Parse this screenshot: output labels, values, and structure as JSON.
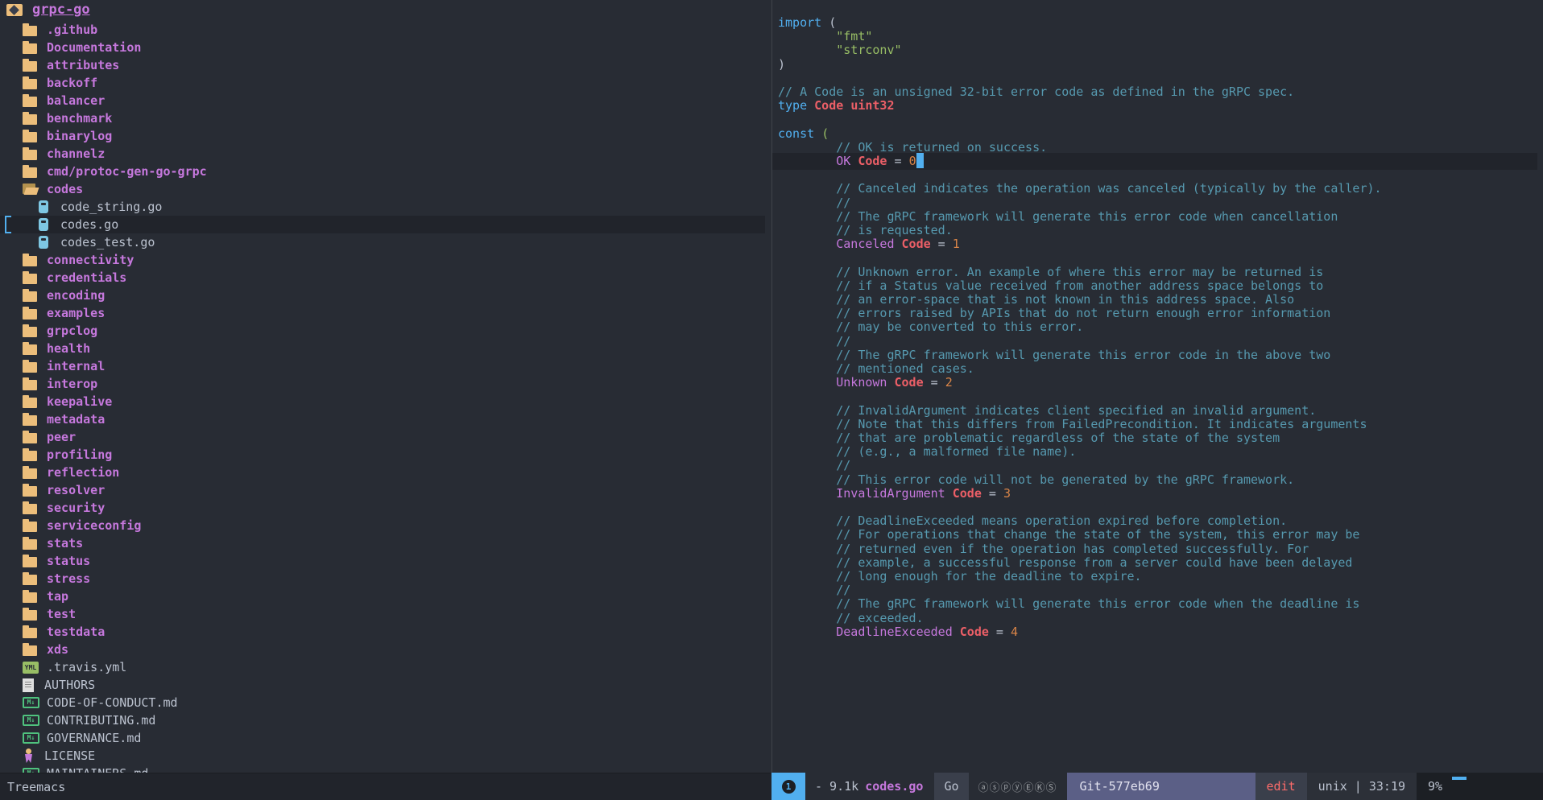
{
  "tree": {
    "root_label": "grpc-go",
    "rows": [
      {
        "label": ".github",
        "kind": "dir",
        "icon": "folder-icon"
      },
      {
        "label": "Documentation",
        "kind": "dir",
        "icon": "folder-icon"
      },
      {
        "label": "attributes",
        "kind": "dir",
        "icon": "folder-icon"
      },
      {
        "label": "backoff",
        "kind": "dir",
        "icon": "folder-icon"
      },
      {
        "label": "balancer",
        "kind": "dir",
        "icon": "folder-icon"
      },
      {
        "label": "benchmark",
        "kind": "dir",
        "icon": "folder-icon"
      },
      {
        "label": "binarylog",
        "kind": "dir",
        "icon": "folder-icon"
      },
      {
        "label": "channelz",
        "kind": "dir",
        "icon": "folder-icon"
      },
      {
        "label": "cmd/protoc-gen-go-grpc",
        "kind": "dir",
        "icon": "folder-icon"
      },
      {
        "label": "codes",
        "kind": "dir",
        "icon": "folder-open-icon",
        "open": true
      },
      {
        "label": "code_string.go",
        "kind": "file",
        "icon": "go-file-icon",
        "child": true
      },
      {
        "label": "codes.go",
        "kind": "file",
        "icon": "go-file-icon",
        "child": true,
        "selected": true
      },
      {
        "label": "codes_test.go",
        "kind": "file",
        "icon": "go-file-icon",
        "child": true
      },
      {
        "label": "connectivity",
        "kind": "dir",
        "icon": "folder-icon"
      },
      {
        "label": "credentials",
        "kind": "dir",
        "icon": "folder-icon"
      },
      {
        "label": "encoding",
        "kind": "dir",
        "icon": "folder-icon"
      },
      {
        "label": "examples",
        "kind": "dir",
        "icon": "folder-icon"
      },
      {
        "label": "grpclog",
        "kind": "dir",
        "icon": "folder-icon"
      },
      {
        "label": "health",
        "kind": "dir",
        "icon": "folder-icon"
      },
      {
        "label": "internal",
        "kind": "dir",
        "icon": "folder-icon"
      },
      {
        "label": "interop",
        "kind": "dir",
        "icon": "folder-icon"
      },
      {
        "label": "keepalive",
        "kind": "dir",
        "icon": "folder-icon"
      },
      {
        "label": "metadata",
        "kind": "dir",
        "icon": "folder-icon"
      },
      {
        "label": "peer",
        "kind": "dir",
        "icon": "folder-icon"
      },
      {
        "label": "profiling",
        "kind": "dir",
        "icon": "folder-icon"
      },
      {
        "label": "reflection",
        "kind": "dir",
        "icon": "folder-icon"
      },
      {
        "label": "resolver",
        "kind": "dir",
        "icon": "folder-icon"
      },
      {
        "label": "security",
        "kind": "dir",
        "icon": "folder-icon"
      },
      {
        "label": "serviceconfig",
        "kind": "dir",
        "icon": "folder-icon"
      },
      {
        "label": "stats",
        "kind": "dir",
        "icon": "folder-icon"
      },
      {
        "label": "status",
        "kind": "dir",
        "icon": "folder-icon"
      },
      {
        "label": "stress",
        "kind": "dir",
        "icon": "folder-icon"
      },
      {
        "label": "tap",
        "kind": "dir",
        "icon": "folder-icon"
      },
      {
        "label": "test",
        "kind": "dir",
        "icon": "folder-icon"
      },
      {
        "label": "testdata",
        "kind": "dir",
        "icon": "folder-icon"
      },
      {
        "label": "xds",
        "kind": "dir",
        "icon": "folder-icon"
      },
      {
        "label": ".travis.yml",
        "kind": "file",
        "icon": "yaml-file-icon",
        "icon_text": "YML"
      },
      {
        "label": "AUTHORS",
        "kind": "file",
        "icon": "text-file-icon"
      },
      {
        "label": "CODE-OF-CONDUCT.md",
        "kind": "file",
        "icon": "markdown-file-icon",
        "icon_text": "M↓"
      },
      {
        "label": "CONTRIBUTING.md",
        "kind": "file",
        "icon": "markdown-file-icon",
        "icon_text": "M↓"
      },
      {
        "label": "GOVERNANCE.md",
        "kind": "file",
        "icon": "markdown-file-icon",
        "icon_text": "M↓"
      },
      {
        "label": "LICENSE",
        "kind": "file",
        "icon": "license-file-icon"
      },
      {
        "label": "MAINTAINERS.md",
        "kind": "file",
        "icon": "markdown-file-icon",
        "icon_text": "M↓"
      }
    ]
  },
  "editor": {
    "lines": [
      {
        "tokens": [
          [
            "kw",
            "import"
          ],
          [
            "punc",
            " ("
          ]
        ]
      },
      {
        "tokens": [
          [
            "str",
            "        \"fmt\""
          ]
        ]
      },
      {
        "tokens": [
          [
            "str",
            "        \"strconv\""
          ]
        ]
      },
      {
        "tokens": [
          [
            "punc",
            ")"
          ]
        ]
      },
      {
        "tokens": []
      },
      {
        "tokens": [
          [
            "cm",
            "// A Code is an unsigned 32-bit error code as defined in the gRPC spec."
          ]
        ]
      },
      {
        "tokens": [
          [
            "kw",
            "type "
          ],
          [
            "type",
            "Code"
          ],
          [
            "punc",
            " "
          ],
          [
            "type",
            "uint32"
          ]
        ]
      },
      {
        "tokens": []
      },
      {
        "tokens": [
          [
            "kw",
            "const "
          ],
          [
            "paren",
            "("
          ]
        ]
      },
      {
        "tokens": [
          [
            "cm",
            "        // OK is returned on success."
          ]
        ]
      },
      {
        "tokens": [
          [
            "const",
            "        OK "
          ],
          [
            "type",
            "Code"
          ],
          [
            "punc",
            " = "
          ],
          [
            "num",
            "0"
          ]
        ],
        "current": true
      },
      {
        "tokens": []
      },
      {
        "tokens": [
          [
            "cm",
            "        // Canceled indicates the operation was canceled (typically by the caller)."
          ]
        ]
      },
      {
        "tokens": [
          [
            "cm",
            "        //"
          ]
        ]
      },
      {
        "tokens": [
          [
            "cm",
            "        // The gRPC framework will generate this error code when cancellation"
          ]
        ]
      },
      {
        "tokens": [
          [
            "cm",
            "        // is requested."
          ]
        ]
      },
      {
        "tokens": [
          [
            "const",
            "        Canceled "
          ],
          [
            "type",
            "Code"
          ],
          [
            "punc",
            " = "
          ],
          [
            "num",
            "1"
          ]
        ]
      },
      {
        "tokens": []
      },
      {
        "tokens": [
          [
            "cm",
            "        // Unknown error. An example of where this error may be returned is"
          ]
        ]
      },
      {
        "tokens": [
          [
            "cm",
            "        // if a Status value received from another address space belongs to"
          ]
        ]
      },
      {
        "tokens": [
          [
            "cm",
            "        // an error-space that is not known in this address space. Also"
          ]
        ]
      },
      {
        "tokens": [
          [
            "cm",
            "        // errors raised by APIs that do not return enough error information"
          ]
        ]
      },
      {
        "tokens": [
          [
            "cm",
            "        // may be converted to this error."
          ]
        ]
      },
      {
        "tokens": [
          [
            "cm",
            "        //"
          ]
        ]
      },
      {
        "tokens": [
          [
            "cm",
            "        // The gRPC framework will generate this error code in the above two"
          ]
        ]
      },
      {
        "tokens": [
          [
            "cm",
            "        // mentioned cases."
          ]
        ]
      },
      {
        "tokens": [
          [
            "const",
            "        Unknown "
          ],
          [
            "type",
            "Code"
          ],
          [
            "punc",
            " = "
          ],
          [
            "num",
            "2"
          ]
        ]
      },
      {
        "tokens": []
      },
      {
        "tokens": [
          [
            "cm",
            "        // InvalidArgument indicates client specified an invalid argument."
          ]
        ]
      },
      {
        "tokens": [
          [
            "cm",
            "        // Note that this differs from FailedPrecondition. It indicates arguments"
          ]
        ]
      },
      {
        "tokens": [
          [
            "cm",
            "        // that are problematic regardless of the state of the system"
          ]
        ]
      },
      {
        "tokens": [
          [
            "cm",
            "        // (e.g., a malformed file name)."
          ]
        ]
      },
      {
        "tokens": [
          [
            "cm",
            "        //"
          ]
        ]
      },
      {
        "tokens": [
          [
            "cm",
            "        // This error code will not be generated by the gRPC framework."
          ]
        ]
      },
      {
        "tokens": [
          [
            "const",
            "        InvalidArgument "
          ],
          [
            "type",
            "Code"
          ],
          [
            "punc",
            " = "
          ],
          [
            "num",
            "3"
          ]
        ]
      },
      {
        "tokens": []
      },
      {
        "tokens": [
          [
            "cm",
            "        // DeadlineExceeded means operation expired before completion."
          ]
        ]
      },
      {
        "tokens": [
          [
            "cm",
            "        // For operations that change the state of the system, this error may be"
          ]
        ]
      },
      {
        "tokens": [
          [
            "cm",
            "        // returned even if the operation has completed successfully. For"
          ]
        ]
      },
      {
        "tokens": [
          [
            "cm",
            "        // example, a successful response from a server could have been delayed"
          ]
        ]
      },
      {
        "tokens": [
          [
            "cm",
            "        // long enough for the deadline to expire."
          ]
        ]
      },
      {
        "tokens": [
          [
            "cm",
            "        //"
          ]
        ]
      },
      {
        "tokens": [
          [
            "cm",
            "        // The gRPC framework will generate this error code when the deadline is"
          ]
        ]
      },
      {
        "tokens": [
          [
            "cm",
            "        // exceeded."
          ]
        ]
      },
      {
        "tokens": [
          [
            "const",
            "        DeadlineExceeded "
          ],
          [
            "type",
            "Code"
          ],
          [
            "punc",
            " = "
          ],
          [
            "num",
            "4"
          ]
        ]
      }
    ]
  },
  "modeline_left": {
    "label": "Treemacs"
  },
  "modeline": {
    "window_number": "1",
    "buffer_size": "- 9.1k",
    "buffer_name": "codes.go",
    "major_mode": "Go",
    "minor_flags": "ⓐⓢⓟⓨⒺⓀⓈ",
    "vcs": "Git-577eb69",
    "state": "edit",
    "eol_encoding": "unix | 33:19",
    "position_percent": "9%"
  },
  "colors": {
    "background": "#282c34",
    "keyword": "#51afef",
    "string": "#98be65",
    "comment": "#5699af",
    "constant": "#c678dd",
    "type": "#ec5f67",
    "number": "#da8548",
    "directory": "#c678dd",
    "folder": "#ecbe7b",
    "vcs_segment": "#5b5f86"
  }
}
